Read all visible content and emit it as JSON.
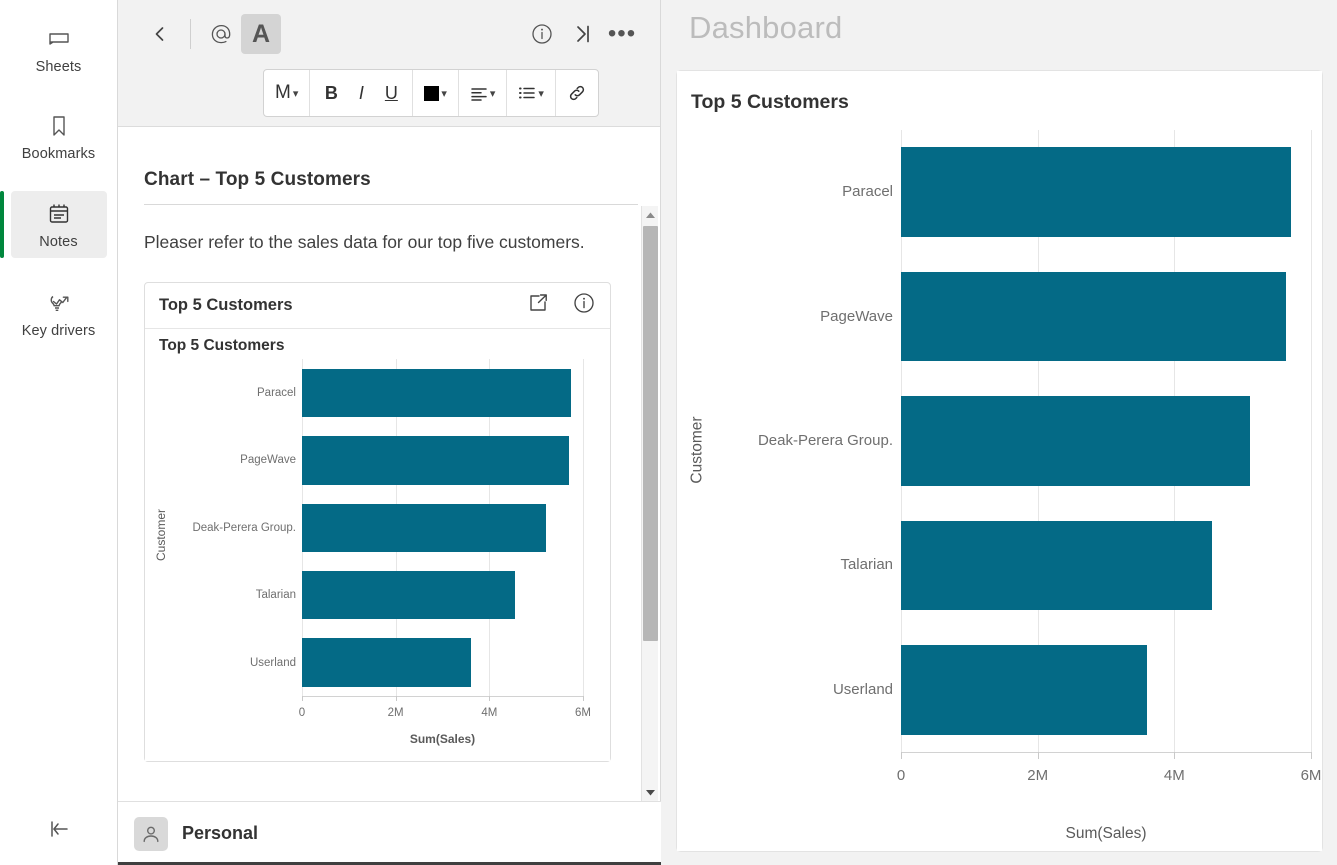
{
  "rail": {
    "items": [
      {
        "label": "Sheets",
        "icon": "sheets-icon",
        "active": false
      },
      {
        "label": "Bookmarks",
        "icon": "bookmark-icon",
        "active": false
      },
      {
        "label": "Notes",
        "icon": "notes-icon",
        "active": true
      },
      {
        "label": "Key drivers",
        "icon": "key-drivers-icon",
        "active": false
      }
    ],
    "collapse_icon": "collapse-left-icon",
    "active_indicator_color": "#00873d"
  },
  "note": {
    "toolbar": {
      "back_icon": "chevron-left-icon",
      "mention_icon": "at-mention-icon",
      "text_icon": "text-format-icon",
      "text_label": "A",
      "info_icon": "info-circle-icon",
      "expand_icon": "expand-right-icon",
      "more_icon": "more-ellipsis-icon",
      "format": {
        "size_label": "M",
        "bold_label": "B",
        "italic_label": "I",
        "underline_label": "U",
        "color_swatch": "#000000",
        "align_icon": "align-left-icon",
        "list_icon": "bullet-list-icon",
        "link_icon": "link-icon",
        "caret_icon": "chevron-down-icon"
      }
    },
    "title": "Chart – Top 5 Customers",
    "body_text": "Pleaser refer to the sales data for our top five customers.",
    "embed": {
      "header_title": "Top 5 Customers",
      "share_icon": "open-external-icon",
      "info_icon": "info-circle-icon"
    },
    "owner": {
      "avatar_icon": "user-avatar-icon",
      "name": "Personal"
    },
    "scrollbar": {
      "up_icon": "caret-up-icon",
      "down_icon": "caret-down-icon"
    }
  },
  "dashboard": {
    "title": "Dashboard"
  },
  "chart_data": [
    {
      "id": "embedded-chart",
      "type": "bar",
      "orientation": "horizontal",
      "title": "Top 5 Customers",
      "categories": [
        "Paracel",
        "PageWave",
        "Deak-Perera Group.",
        "Talarian",
        "Userland"
      ],
      "values": [
        5750000,
        5700000,
        5200000,
        4550000,
        3600000
      ],
      "xlabel": "Sum(Sales)",
      "ylabel": "Customer",
      "xlim": [
        0,
        6000000
      ],
      "xticks": [
        0,
        2000000,
        4000000,
        6000000
      ],
      "xtick_labels": [
        "0",
        "2M",
        "4M",
        "6M"
      ],
      "grid": true,
      "legend": false,
      "bar_color": "#046a86"
    },
    {
      "id": "dashboard-chart",
      "type": "bar",
      "orientation": "horizontal",
      "title": "Top 5 Customers",
      "categories": [
        "Paracel",
        "PageWave",
        "Deak-Perera Group.",
        "Talarian",
        "Userland"
      ],
      "values": [
        5700000,
        5630000,
        5110000,
        4550000,
        3600000
      ],
      "xlabel": "Sum(Sales)",
      "ylabel": "Customer",
      "xlim": [
        0,
        6000000
      ],
      "xticks": [
        0,
        2000000,
        4000000,
        6000000
      ],
      "xtick_labels": [
        "0",
        "2M",
        "4M",
        "6M"
      ],
      "grid": true,
      "legend": false,
      "bar_color": "#046a86"
    }
  ]
}
